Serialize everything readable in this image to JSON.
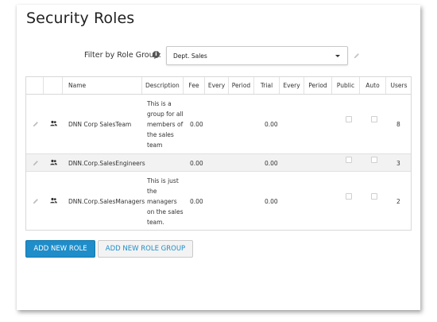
{
  "page": {
    "title": "Security Roles"
  },
  "filter": {
    "label": "Filter by Role Group:",
    "selected": "Dept. Sales"
  },
  "table": {
    "headers": {
      "name": "Name",
      "description": "Description",
      "fee": "Fee",
      "every1": "Every",
      "period1": "Period",
      "trial": "Trial",
      "every2": "Every",
      "period2": "Period",
      "public": "Public",
      "auto": "Auto",
      "users": "Users"
    },
    "rows": [
      {
        "name": "DNN Corp SalesTeam",
        "description": [
          "This is a",
          "group for all",
          "members of",
          "the sales",
          "team"
        ],
        "fee": "0.00",
        "trial": "0.00",
        "public": false,
        "auto": false,
        "users": "8"
      },
      {
        "name": "DNN.Corp.SalesEngineers",
        "description": [],
        "fee": "0.00",
        "trial": "0.00",
        "public": false,
        "auto": false,
        "users": "3"
      },
      {
        "name": "DNN.Corp.SalesManagers",
        "description": [
          "This is just",
          "the",
          "managers",
          "on the sales",
          "team."
        ],
        "fee": "0.00",
        "trial": "0.00",
        "public": false,
        "auto": false,
        "users": "2"
      }
    ]
  },
  "actions": {
    "add_role": "ADD NEW ROLE",
    "add_role_group": "ADD NEW ROLE GROUP"
  },
  "colors": {
    "accent": "#1e8dc9",
    "row_alt": "#f2f2f2"
  },
  "icons": {
    "edit": "pencil-icon",
    "users": "users-icon",
    "info": "info-icon"
  }
}
